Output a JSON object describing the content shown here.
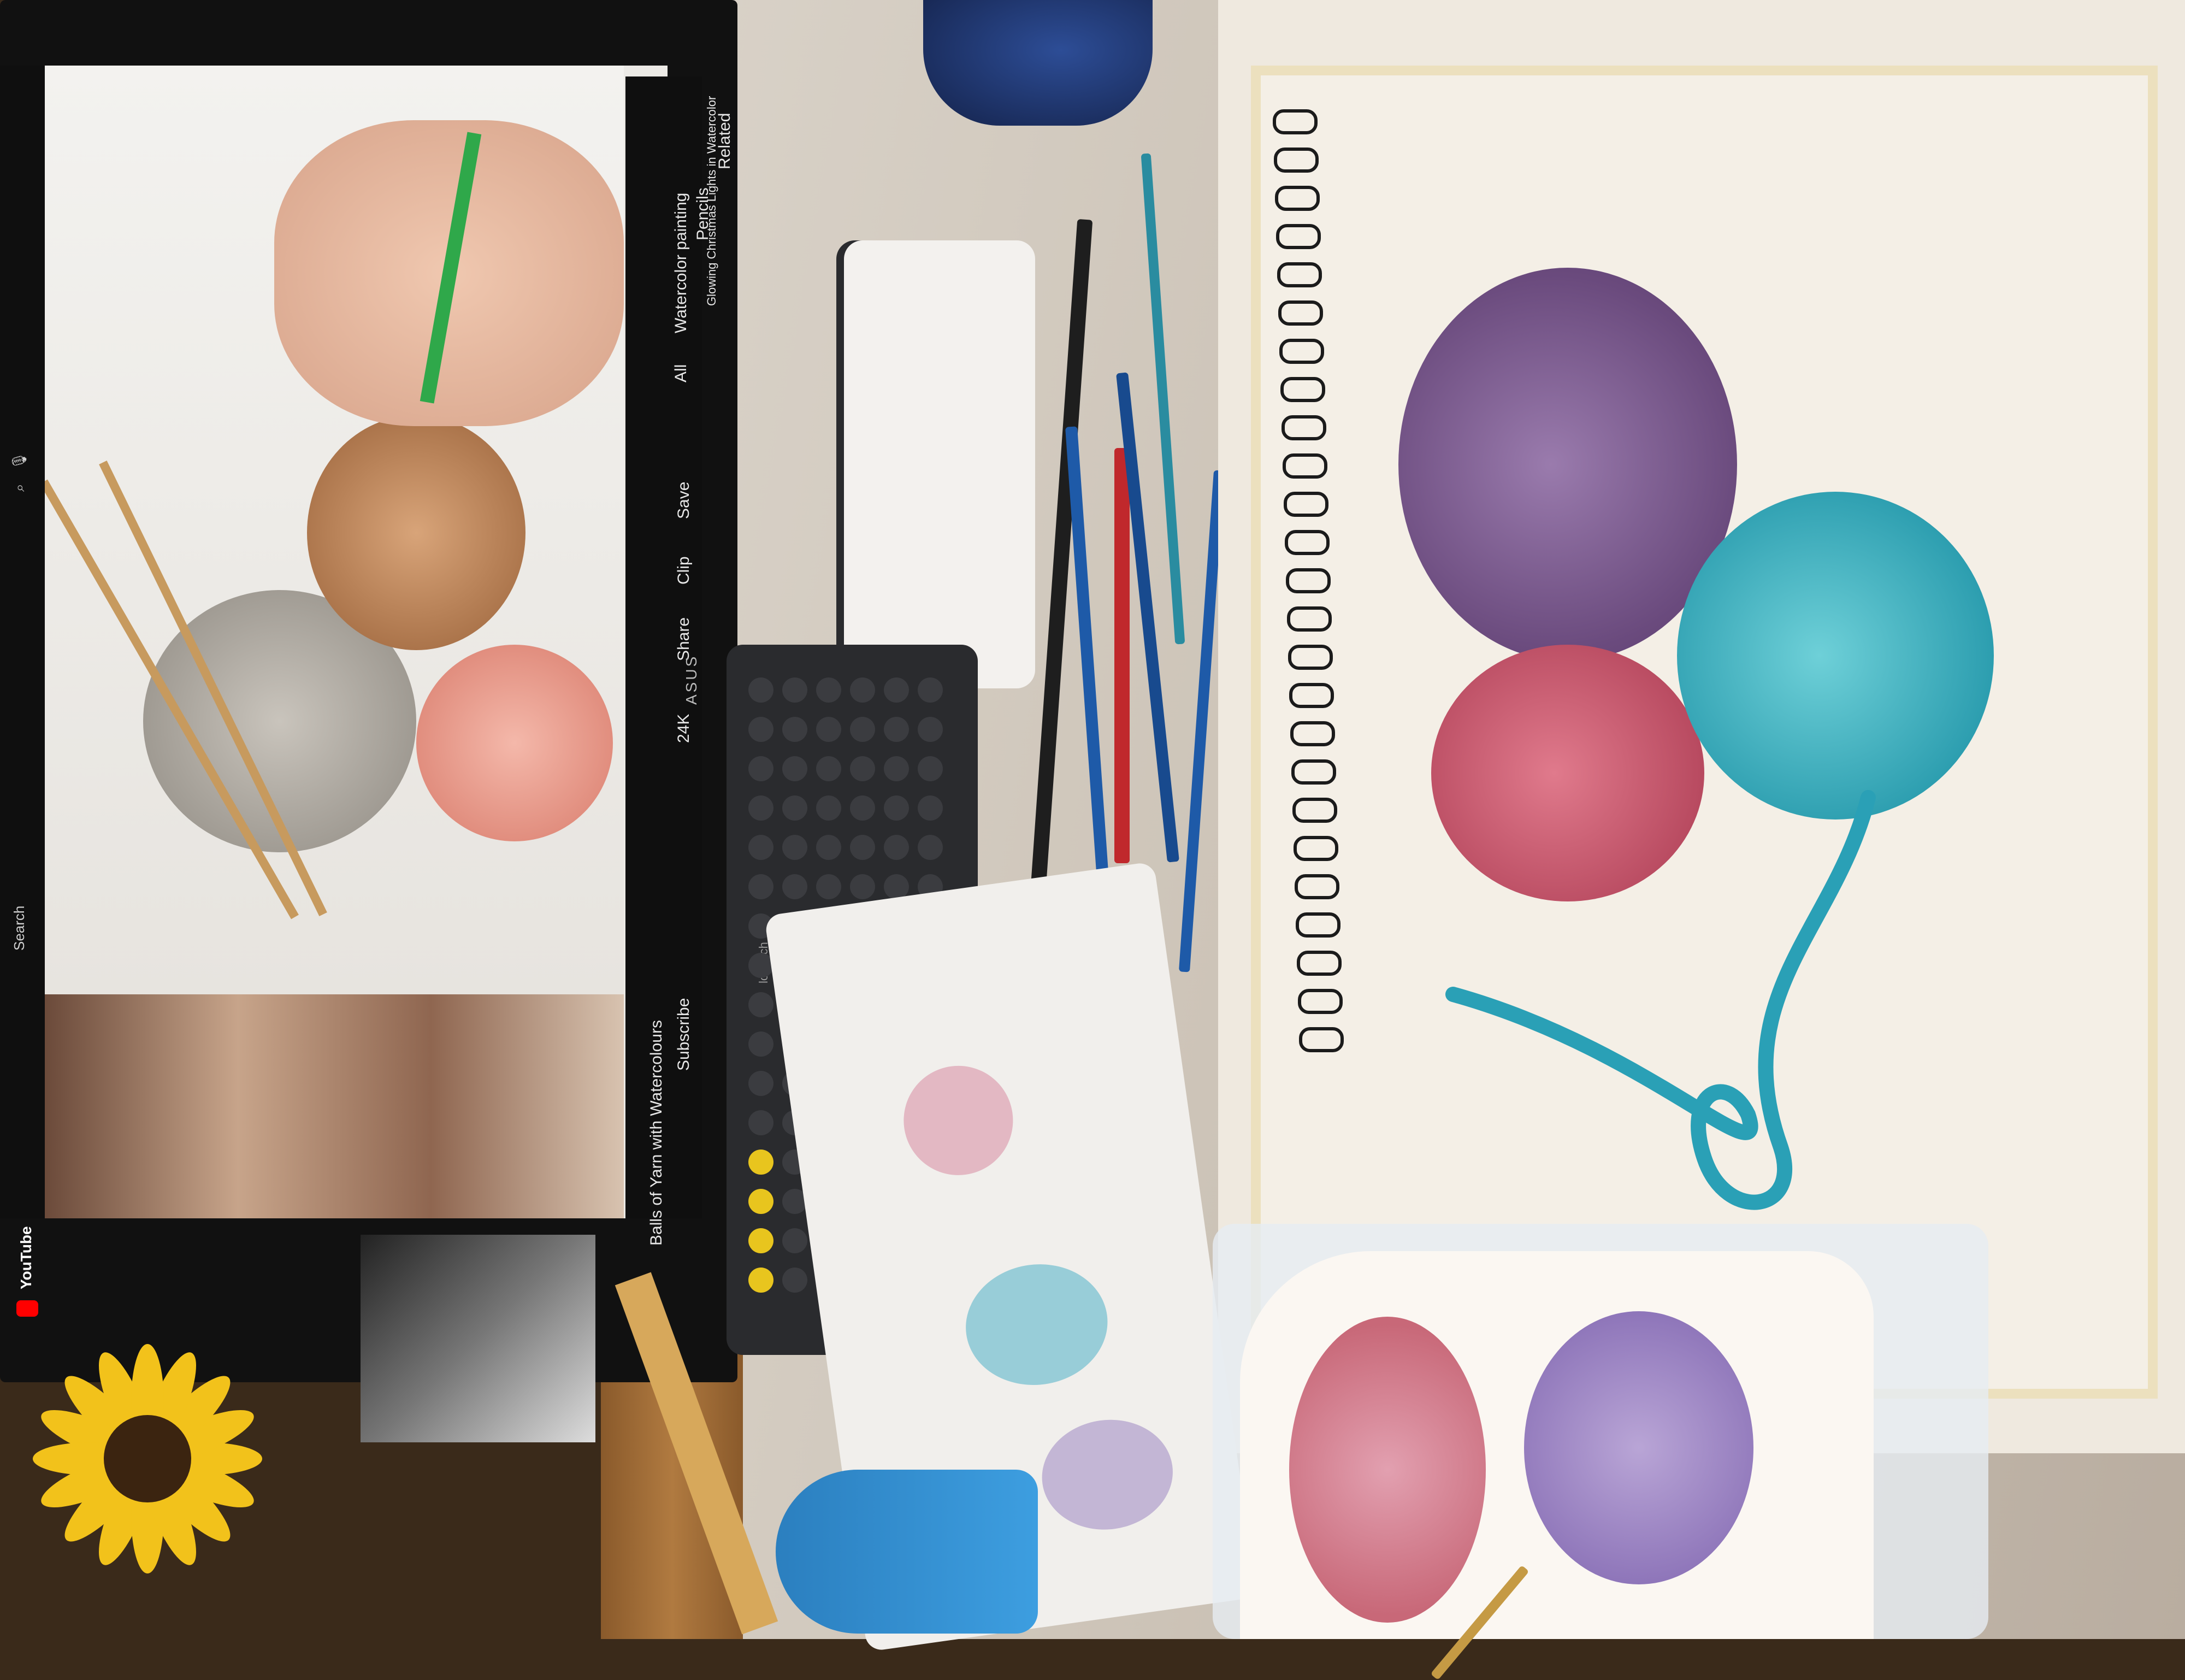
{
  "scene": {
    "description_tag": "desk-with-monitor-and-watercolor-painting"
  },
  "monitor": {
    "brand": "ASUS",
    "youtube": {
      "logo": "YouTube",
      "search_placeholder": "Search",
      "video_title": "Balls of Yarn with Watercolours",
      "channel_abbrev": "Subscribe",
      "actions": [
        "Share",
        "Clip",
        "Save"
      ],
      "likes": "24K",
      "chips": [
        "All",
        "Watercolor painting",
        "Pencils",
        "Related"
      ],
      "next_video": "Glowing Christmas Lights in Watercolor"
    }
  },
  "keyboard": {
    "brand": "logitech"
  },
  "colors": {
    "purple_yarn": "#7a5a8c",
    "pink_yarn": "#c85a6e",
    "teal_yarn": "#38a8b8",
    "video_brown_yarn": "#b07a4f",
    "video_pink_yarn": "#e99a8a",
    "video_gray_yarn": "#a9a49c",
    "sunflower_yellow": "#f2c21b"
  }
}
